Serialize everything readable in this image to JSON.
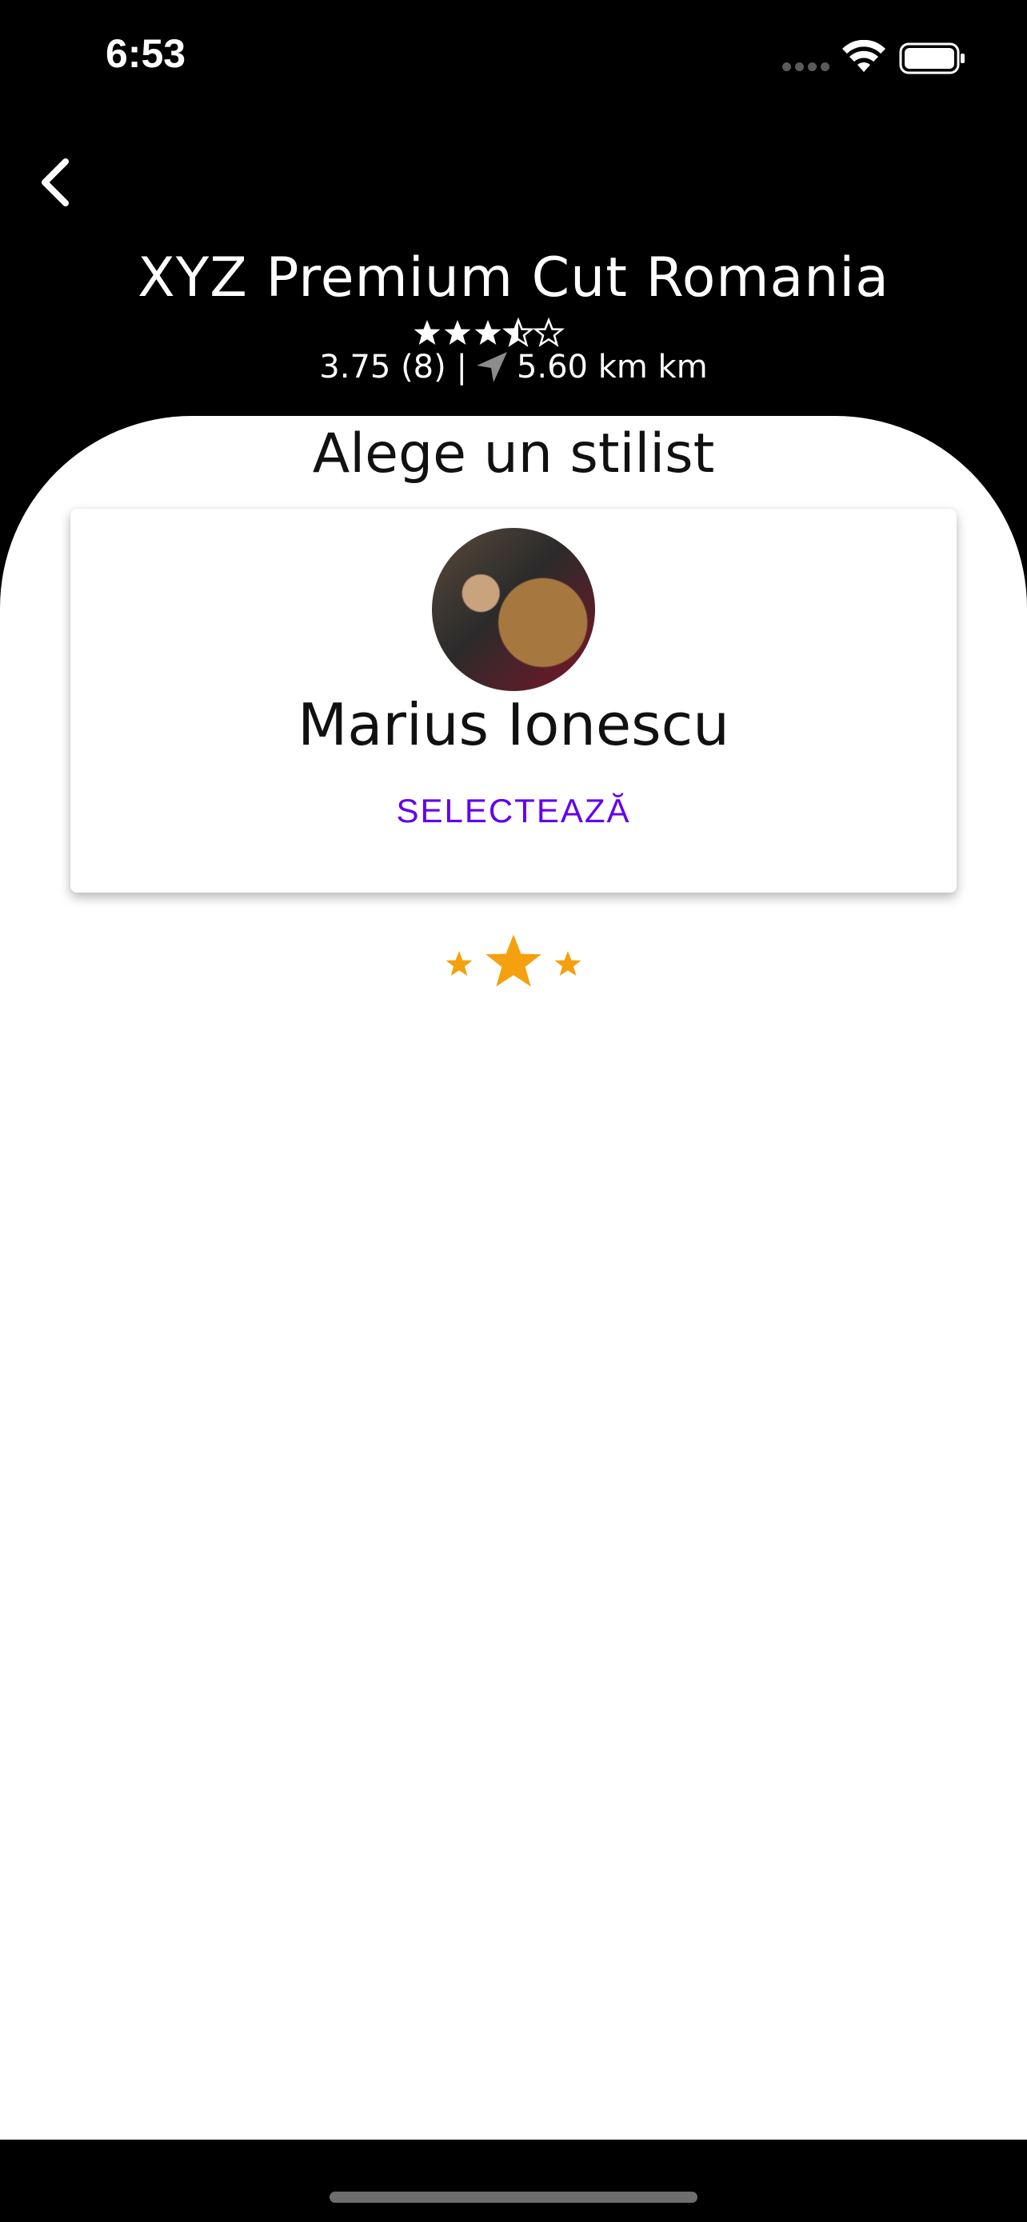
{
  "status_bar": {
    "time": "6:53"
  },
  "header": {
    "shop_name": "XYZ Premium Cut Romania",
    "rating": 3.75,
    "meta_left": "3.75 (8) |",
    "distance": "5.60 km km"
  },
  "section": {
    "title": "Alege un stilist"
  },
  "stylists": [
    {
      "name": "Marius Ionescu",
      "action_label": "SELECTEAZĂ"
    }
  ],
  "colors": {
    "accent": "#6200ee",
    "loader_star": "#f5a00f"
  }
}
